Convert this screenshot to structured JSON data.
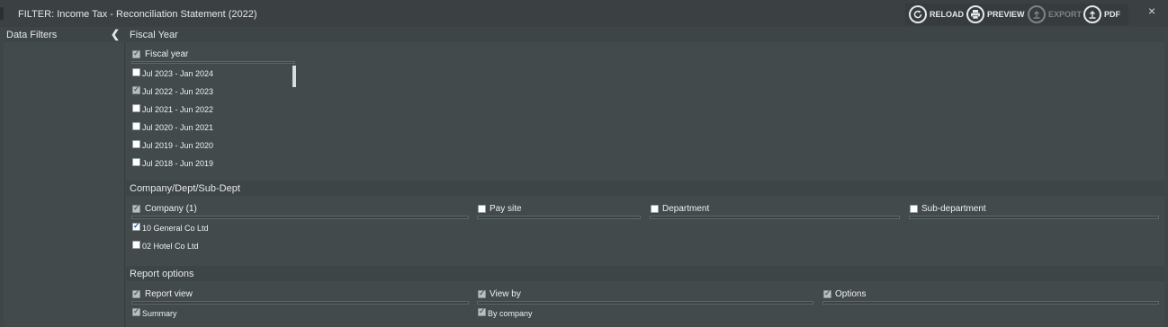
{
  "titlebar": {
    "title": "FILTER: Income Tax - Reconciliation Statement (2022)",
    "actions": [
      {
        "label": "RELOAD",
        "icon": "reload-icon",
        "enabled": true
      },
      {
        "label": "PREVIEW",
        "icon": "printer-icon",
        "enabled": true
      },
      {
        "label": "EXPORT",
        "icon": "upload-icon",
        "enabled": false
      },
      {
        "label": "PDF",
        "icon": "upload-icon",
        "enabled": true
      }
    ],
    "close_label": "×"
  },
  "sidebar": {
    "label": "Data Filters",
    "collapse_icon": "chevron-left-icon"
  },
  "fiscal": {
    "section_title": "Fiscal Year",
    "header_label": "Fiscal year",
    "options": [
      {
        "label": "Jul 2023 - Jan 2024",
        "checked": false
      },
      {
        "label": "Jul 2022 - Jun 2023",
        "checked": true
      },
      {
        "label": "Jul 2021 - Jun 2022",
        "checked": false
      },
      {
        "label": "Jul 2020 - Jun 2021",
        "checked": false
      },
      {
        "label": "Jul 2019 - Jun 2020",
        "checked": false
      },
      {
        "label": "Jul 2018 - Jun 2019",
        "checked": false
      }
    ]
  },
  "company": {
    "section_title": "Company/Dept/Sub-Dept",
    "columns": {
      "company": "Company (1)",
      "paysite": "Pay site",
      "department": "Department",
      "subdepartment": "Sub-department"
    },
    "companies": [
      {
        "label": "10 General Co Ltd",
        "checked": true
      },
      {
        "label": "02 Hotel Co Ltd",
        "checked": false
      }
    ]
  },
  "report": {
    "section_title": "Report options",
    "columns": {
      "report_view": "Report view",
      "view_by": "View by",
      "options": "Options"
    },
    "report_view_value": "Summary",
    "view_by_value": "By company"
  }
}
